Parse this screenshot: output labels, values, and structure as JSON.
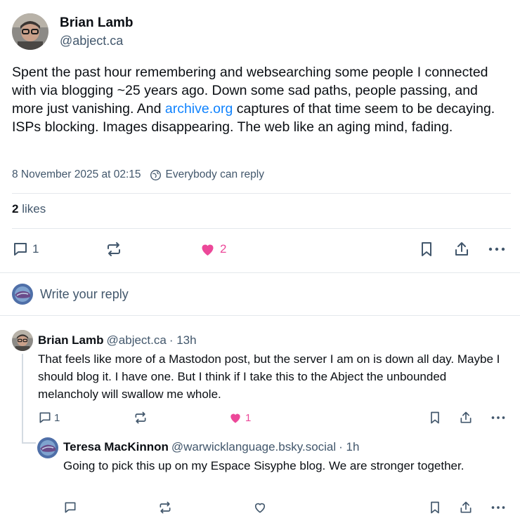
{
  "post": {
    "author_name": "Brian Lamb",
    "author_handle": "@abject.ca",
    "text_before_link": "Spent the past hour remembering and websearching some people I connected with via blogging ~25 years ago. Down some sad paths, people passing, and more just vanishing. And ",
    "link_text": "archive.org",
    "text_after_link": " captures of that time seem to be decaying. ISPs blocking. Images disappearing. The web like an aging mind, fading.",
    "timestamp": "8 November 2025 at 02:15",
    "reply_setting": "Everybody can reply",
    "likes_count": "2",
    "likes_label": "likes",
    "reply_count": "1",
    "like_count": "2"
  },
  "composer": {
    "placeholder": "Write your reply"
  },
  "replies": [
    {
      "author_name": "Brian Lamb",
      "author_handle": "@abject.ca",
      "time": "· 13h",
      "text": "That feels like more of a Mastodon post, but the server I am on is down all day. Maybe I should blog it. I have one. But I think if I take this to the Abject the unbounded melancholy will swallow me whole.",
      "reply_count": "1",
      "like_count": "1"
    },
    {
      "author_name": "Teresa MacKinnon",
      "author_handle": "@warwicklanguage.bsky.social",
      "time": "· 1h",
      "text": "Going to pick this up on my Espace Sisyphe blog. We are stronger together."
    }
  ],
  "colors": {
    "accent_link": "#1083fe",
    "like_pink": "#ec4899",
    "muted_text": "#42576c",
    "divider": "#e4e8ec"
  },
  "icons": [
    "reply-icon",
    "repost-icon",
    "heart-icon",
    "bookmark-icon",
    "share-icon",
    "more-icon",
    "globe-icon"
  ]
}
